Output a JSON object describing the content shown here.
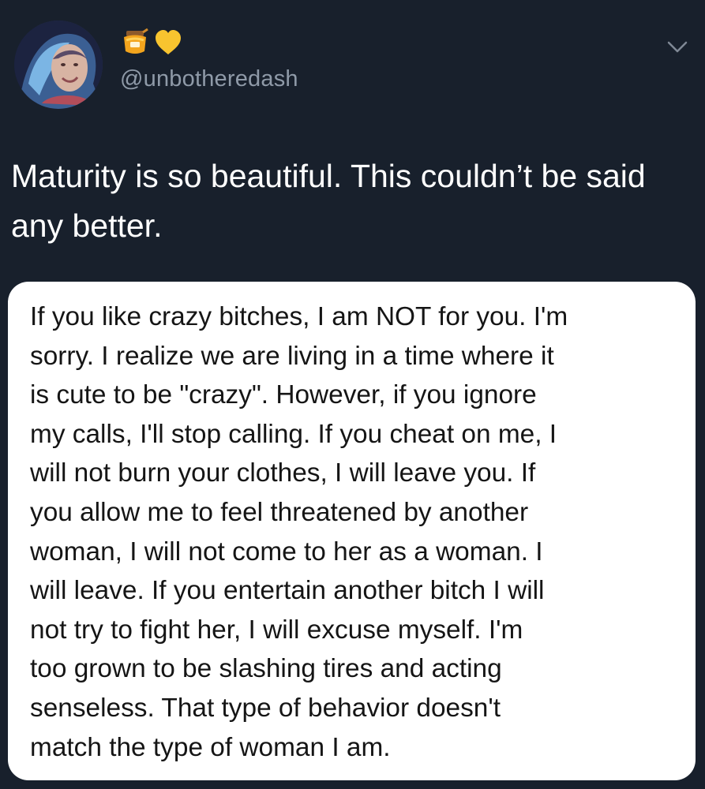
{
  "profile": {
    "handle": "@unbotheredash",
    "display_name_icons": [
      "honey-pot-icon",
      "yellow-heart-icon"
    ],
    "avatar_icon": "profile-photo"
  },
  "tweet": {
    "text": "Maturity is so beautiful. This couldn’t be said any better.",
    "menu_icon": "chevron-down-icon"
  },
  "note": {
    "text": "If you like crazy bitches, I am NOT for you. I'm\nsorry. I realize we are living in a time where it\nis cute to be \"crazy\". However, if you ignore\nmy calls, I'll stop calling. If you cheat on me, I\nwill not burn your clothes, I will leave you. If\nyou allow me to feel threatened by another\nwoman, I will not come to her as a woman. I\nwill leave. If you entertain another bitch I will\nnot try to fight her, I will excuse myself. I'm\ntoo grown to be slashing tires and acting\nsenseless. That type of behavior doesn't\nmatch the type of woman I am."
  },
  "colors": {
    "background": "#18202c",
    "handle": "#8f9aa8",
    "text": "#ffffff",
    "card": "#ffffff",
    "card_text": "#151515"
  }
}
